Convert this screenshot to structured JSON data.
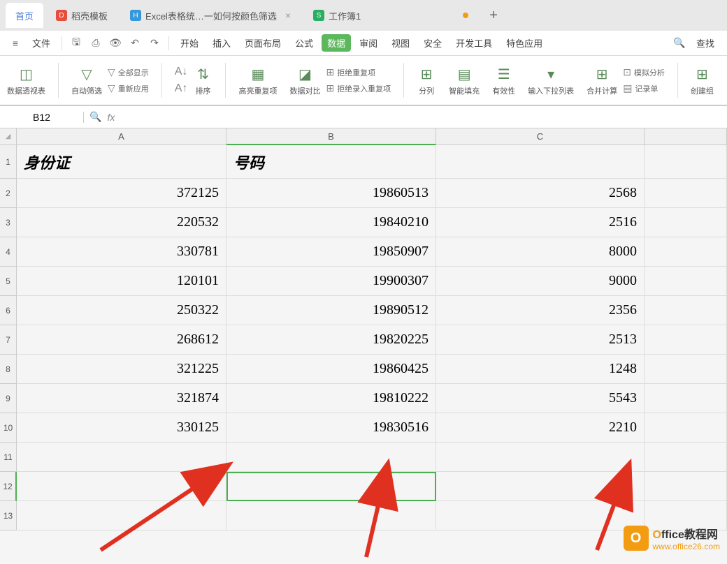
{
  "tabs": {
    "home": "首页",
    "t1": "稻壳模板",
    "t2": "Excel表格统…一如何按颜色筛选",
    "t3": "工作簿1"
  },
  "menu": {
    "file": "文件",
    "items": [
      "开始",
      "插入",
      "页面布局",
      "公式",
      "数据",
      "审阅",
      "视图",
      "安全",
      "开发工具",
      "特色应用"
    ],
    "search": "查找"
  },
  "ribbon": {
    "pivot": "数据透视表",
    "filter": "自动筛选",
    "show_all": "全部显示",
    "reapply": "重新应用",
    "sort_icon": "A↓",
    "sort": "排序",
    "dedup": "高亮重复项",
    "validation": "数据对比",
    "reject": "拒绝重复项",
    "reject2": "拒绝录入重复项",
    "split": "分列",
    "fill": "智能填充",
    "validity": "有效性",
    "dropdown": "输入下拉列表",
    "consolidate": "合并计算",
    "record": "记录单",
    "simulate": "模拟分析",
    "create": "创建组"
  },
  "formula_bar": {
    "cell_ref": "B12",
    "fx": "fx"
  },
  "columns": [
    "A",
    "B",
    "C"
  ],
  "rows": [
    "1",
    "2",
    "3",
    "4",
    "5",
    "6",
    "7",
    "8",
    "9",
    "10",
    "11",
    "12",
    "13"
  ],
  "headers": {
    "a": "身份证",
    "b": "号码"
  },
  "data": [
    {
      "a": "372125",
      "b": "19860513",
      "c": "2568"
    },
    {
      "a": "220532",
      "b": "19840210",
      "c": "2516"
    },
    {
      "a": "330781",
      "b": "19850907",
      "c": "8000"
    },
    {
      "a": "120101",
      "b": "19900307",
      "c": "9000"
    },
    {
      "a": "250322",
      "b": "19890512",
      "c": "2356"
    },
    {
      "a": "268612",
      "b": "19820225",
      "c": "2513"
    },
    {
      "a": "321225",
      "b": "19860425",
      "c": "1248"
    },
    {
      "a": "321874",
      "b": "19810222",
      "c": "5543"
    },
    {
      "a": "330125",
      "b": "19830516",
      "c": "2210"
    }
  ],
  "watermark": {
    "brand_o": "O",
    "brand_rest": "ffice教程网",
    "url": "www.office26.com",
    "logo": "O"
  }
}
